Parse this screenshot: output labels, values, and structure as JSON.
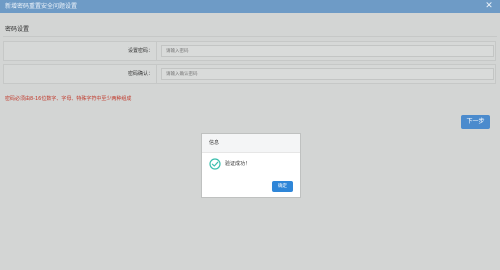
{
  "window": {
    "title": "新增密码重置安全问题设置",
    "close_glyph": "✕"
  },
  "section": {
    "title": "密码设置"
  },
  "form": {
    "fields": [
      {
        "label": "设置密码：",
        "placeholder": "请输入密码",
        "value": ""
      },
      {
        "label": "密码确认：",
        "placeholder": "请输入确认密码",
        "value": ""
      }
    ],
    "hint": "密码必须由8-16位数字、字母、特殊字符中至少两种组成"
  },
  "actions": {
    "next_label": "下一步"
  },
  "dialog": {
    "title": "信息",
    "message": "验证成功！",
    "ok_label": "确定",
    "icon": "check-circle-icon",
    "icon_color": "#3cbfae"
  },
  "colors": {
    "titlebar": "#6e9bc6",
    "hint_text": "#c0392b",
    "primary_button": "#4b8bcd",
    "dialog_button": "#2f86d8"
  }
}
